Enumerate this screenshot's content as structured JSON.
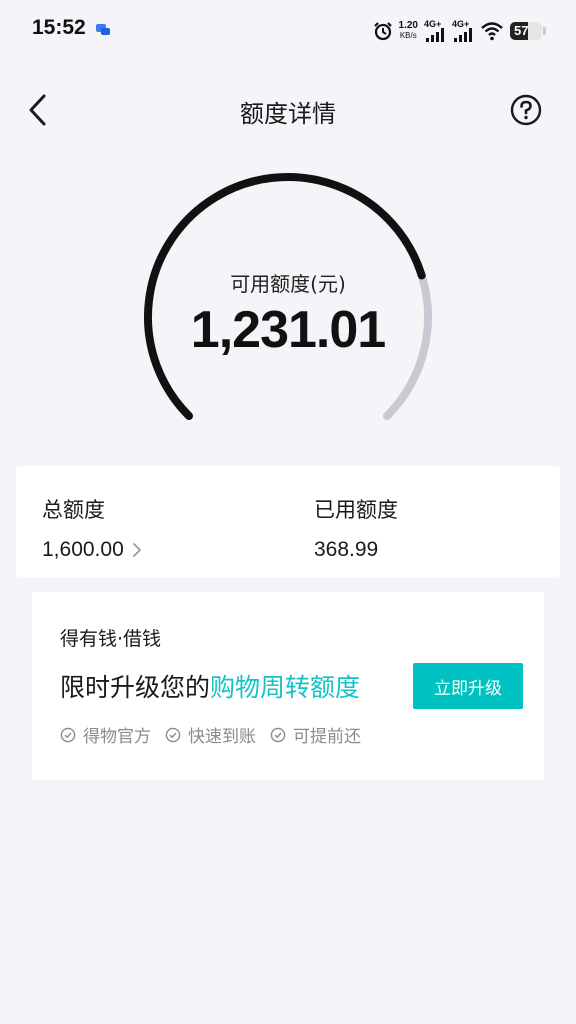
{
  "status_bar": {
    "time": "15:52",
    "net_speed_value": "1.20",
    "net_speed_unit": "KB/s",
    "signal1_label": "4G+",
    "signal2_label": "4G+",
    "battery_level": "57"
  },
  "header": {
    "title": "额度详情"
  },
  "gauge": {
    "label": "可用额度(元)",
    "value": "1,231.01",
    "used_fraction": 0.2306
  },
  "summary": {
    "total_label": "总额度",
    "total_value": "1,600.00",
    "used_label": "已用额度",
    "used_value": "368.99"
  },
  "promo": {
    "brand": "得有钱·借钱",
    "headline_prefix": "限时升级您的",
    "headline_highlight": "购物周转额度",
    "button_label": "立即升级",
    "features": [
      "得物官方",
      "快速到账",
      "可提前还"
    ]
  },
  "colors": {
    "accent": "#01c2c3",
    "highlight_text": "#14c4c4",
    "gauge_available": "#111111",
    "gauge_used": "#c9c9d3",
    "background": "#f5f5f9"
  }
}
